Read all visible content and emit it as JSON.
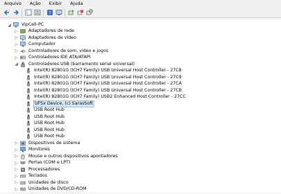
{
  "menu": {
    "file": "Arquivo",
    "action": "Ação",
    "view": "Exibir",
    "help": "Ajuda"
  },
  "toolbar": {
    "icons": [
      "back-icon",
      "forward-icon",
      "properties-icon",
      "console-tree-icon",
      "help-icon",
      "scan-hardware-icon",
      "update-driver-icon",
      "uninstall-icon",
      "disable-icon"
    ]
  },
  "tree": {
    "root": "VipCell-PC",
    "categories_top": [
      "Adaptadores de rede",
      "Adaptadores de vídeo",
      "Computador",
      "Controladores de som, vídeo e jogos",
      "Controladores IDE ATA/ATAPI"
    ],
    "usb_category": "Controladores USB (barramento serial universal)",
    "usb_children": [
      "Intel(R) 82801G (ICH7 Family) USB Universal Host Controller - 27C8",
      "Intel(R) 82801G (ICH7 Family) USB Universal Host Controller - 27C9",
      "Intel(R) 82801G (ICH7 Family) USB Universal Host Controller - 27CA",
      "Intel(R) 82801G (ICH7 Family) USB Universal Host Controller - 27CB",
      "Intel(R) 82801G (ICH7 Family) USB2 Enhanced Host Controller - 27CC",
      "UFSx Device, (c) SarasSoft",
      "USB Root Hub",
      "USB Root Hub",
      "USB Root Hub",
      "USB Root Hub",
      "USB Root Hub"
    ],
    "categories_bottom": [
      "Dispositivos de sistema",
      "Monitores",
      "Mouse e outros dispositivos apontadores",
      "Portas (COM e LPT)",
      "Processadores",
      "Teclados",
      "Unidades de disco",
      "Unidades de DVD/CD-ROM"
    ]
  }
}
